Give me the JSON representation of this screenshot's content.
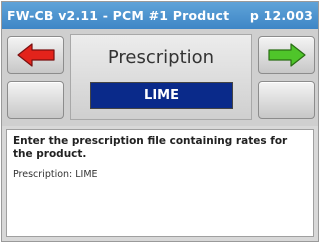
{
  "titlebar": {
    "title": "FW-CB v2.11 - PCM #1 Product",
    "page": "p 12.003"
  },
  "header": {
    "title": "Prescription",
    "value": "LIME"
  },
  "help": {
    "main": "Enter the prescription file containing rates for the product.",
    "detail": "Prescription: LIME"
  },
  "colors": {
    "titlebar": "#4a93cf",
    "value_box": "#0a2a8a",
    "left_arrow": "#e3231b",
    "right_arrow": "#4fc52a"
  },
  "icons": {
    "left": "left-arrow-icon",
    "right": "right-arrow-icon"
  }
}
